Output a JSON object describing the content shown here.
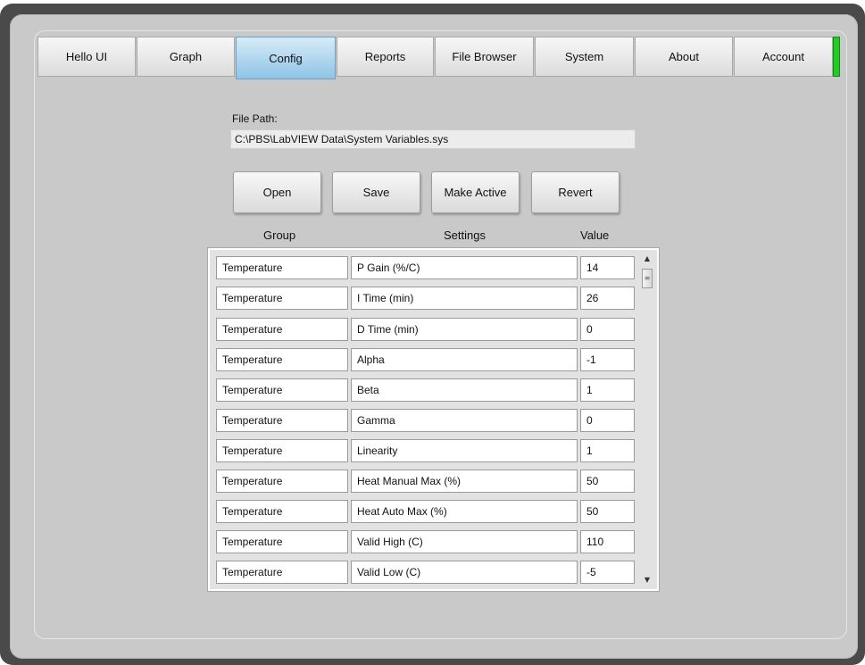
{
  "tabs": [
    {
      "label": "Hello UI"
    },
    {
      "label": "Graph"
    },
    {
      "label": "Config"
    },
    {
      "label": "Reports"
    },
    {
      "label": "File Browser"
    },
    {
      "label": "System"
    },
    {
      "label": "About"
    },
    {
      "label": "Account"
    }
  ],
  "active_tab": "Config",
  "status_color": "#22cc22",
  "file": {
    "label": "File Path:",
    "path": "C:\\PBS\\LabVIEW Data\\System Variables.sys"
  },
  "buttons": {
    "open": "Open",
    "save": "Save",
    "make_active": "Make Active",
    "revert": "Revert"
  },
  "table": {
    "headers": {
      "group": "Group",
      "settings": "Settings",
      "value": "Value"
    },
    "rows": [
      {
        "group": "Temperature",
        "setting": "P Gain (%/C)",
        "value": "14"
      },
      {
        "group": "Temperature",
        "setting": "I Time (min)",
        "value": "26"
      },
      {
        "group": "Temperature",
        "setting": "D Time (min)",
        "value": "0"
      },
      {
        "group": "Temperature",
        "setting": "Alpha",
        "value": "-1"
      },
      {
        "group": "Temperature",
        "setting": "Beta",
        "value": "1"
      },
      {
        "group": "Temperature",
        "setting": "Gamma",
        "value": "0"
      },
      {
        "group": "Temperature",
        "setting": "Linearity",
        "value": "1"
      },
      {
        "group": "Temperature",
        "setting": "Heat Manual Max (%)",
        "value": "50"
      },
      {
        "group": "Temperature",
        "setting": "Heat Auto Max (%)",
        "value": "50"
      },
      {
        "group": "Temperature",
        "setting": "Valid High (C)",
        "value": "110"
      },
      {
        "group": "Temperature",
        "setting": "Valid Low (C)",
        "value": "-5"
      }
    ]
  },
  "scrollbar": {
    "up_icon": "scroll-up-arrow",
    "down_icon": "scroll-down-arrow"
  }
}
